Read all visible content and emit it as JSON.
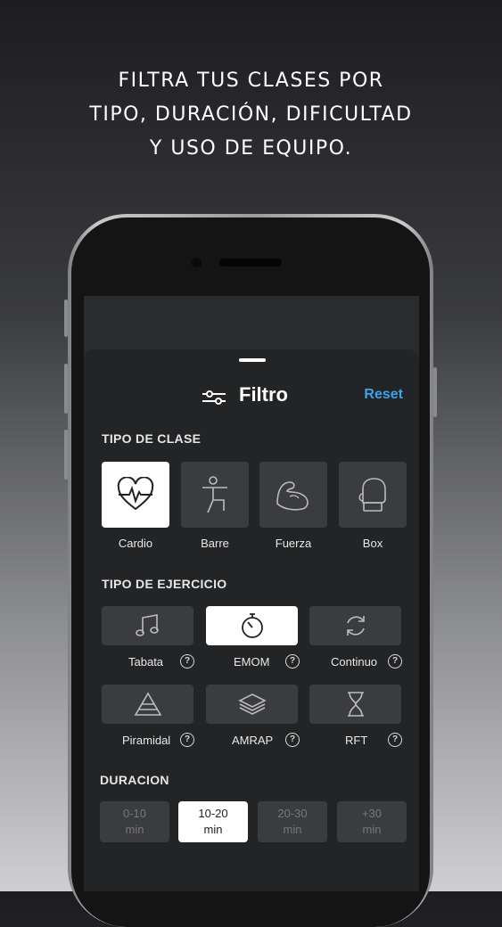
{
  "headline": {
    "line1": "FILTRA TUS CLASES POR",
    "line2": "TIPO, DURACIÓN, DIFICULTAD",
    "line3": "Y USO DE EQUIPO."
  },
  "sheet": {
    "title": "Filtro",
    "reset_label": "Reset"
  },
  "tipo_clase": {
    "heading": "TIPO DE CLASE",
    "items": [
      {
        "label": "Cardio",
        "icon": "heart-pulse-icon",
        "selected": true
      },
      {
        "label": "Barre",
        "icon": "ballet-figure-icon",
        "selected": false
      },
      {
        "label": "Fuerza",
        "icon": "flexed-arm-icon",
        "selected": false
      },
      {
        "label": "Box",
        "icon": "boxing-glove-icon",
        "selected": false
      }
    ]
  },
  "tipo_ejercicio": {
    "heading": "TIPO DE EJERCICIO",
    "help_glyph": "?",
    "items": [
      {
        "label": "Tabata",
        "icon": "music-note-icon",
        "selected": false
      },
      {
        "label": "EMOM",
        "icon": "stopwatch-icon",
        "selected": true
      },
      {
        "label": "Continuo",
        "icon": "refresh-icon",
        "selected": false
      },
      {
        "label": "Piramidal",
        "icon": "pyramid-icon",
        "selected": false
      },
      {
        "label": "AMRAP",
        "icon": "layers-icon",
        "selected": false
      },
      {
        "label": "RFT",
        "icon": "hourglass-icon",
        "selected": false
      }
    ]
  },
  "duracion": {
    "heading": "DURACION",
    "options": [
      {
        "value": "0-10",
        "unit": "min",
        "selected": false
      },
      {
        "value": "10-20",
        "unit": "min",
        "selected": true
      },
      {
        "value": "20-30",
        "unit": "min",
        "selected": false
      },
      {
        "value": "+30",
        "unit": "min",
        "selected": false
      }
    ]
  },
  "colors": {
    "accent": "#3aa3ea",
    "tile": "#3b3c3f",
    "selected": "#ffffff"
  }
}
